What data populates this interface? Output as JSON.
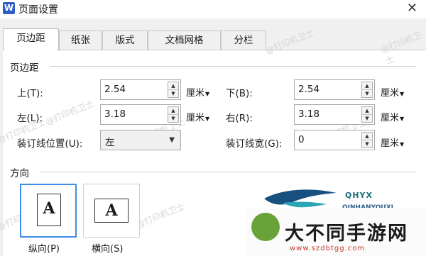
{
  "window": {
    "app_icon": "W",
    "title": "页面设置",
    "close_glyph": "✕"
  },
  "tabs": [
    {
      "label": "页边距",
      "active": true
    },
    {
      "label": "纸张"
    },
    {
      "label": "版式"
    },
    {
      "label": "文档网格"
    },
    {
      "label": "分栏"
    }
  ],
  "margins": {
    "title": "页边距",
    "top": {
      "label": "上(T):",
      "value": "2.54",
      "unit": "厘米"
    },
    "bottom": {
      "label": "下(B):",
      "value": "2.54",
      "unit": "厘米"
    },
    "left": {
      "label": "左(L):",
      "value": "3.18",
      "unit": "厘米"
    },
    "right": {
      "label": "右(R):",
      "value": "3.18",
      "unit": "厘米"
    },
    "gutter_position": {
      "label": "装订线位置(U):",
      "value": "左"
    },
    "gutter_width": {
      "label": "装订线宽(G):",
      "value": "0",
      "unit": "厘米"
    }
  },
  "orientation": {
    "title": "方向",
    "portrait": {
      "label": "纵向(P)",
      "glyph": "A",
      "selected": true
    },
    "landscape": {
      "label": "横向(S)",
      "glyph": "A"
    }
  },
  "watermark_text": "@打印机卫士",
  "logo": {
    "name": "QHYX",
    "sub": "QINHANYOUXI"
  },
  "brand": {
    "name": "大不同手游网",
    "url": "www.szdbtgg.com"
  }
}
